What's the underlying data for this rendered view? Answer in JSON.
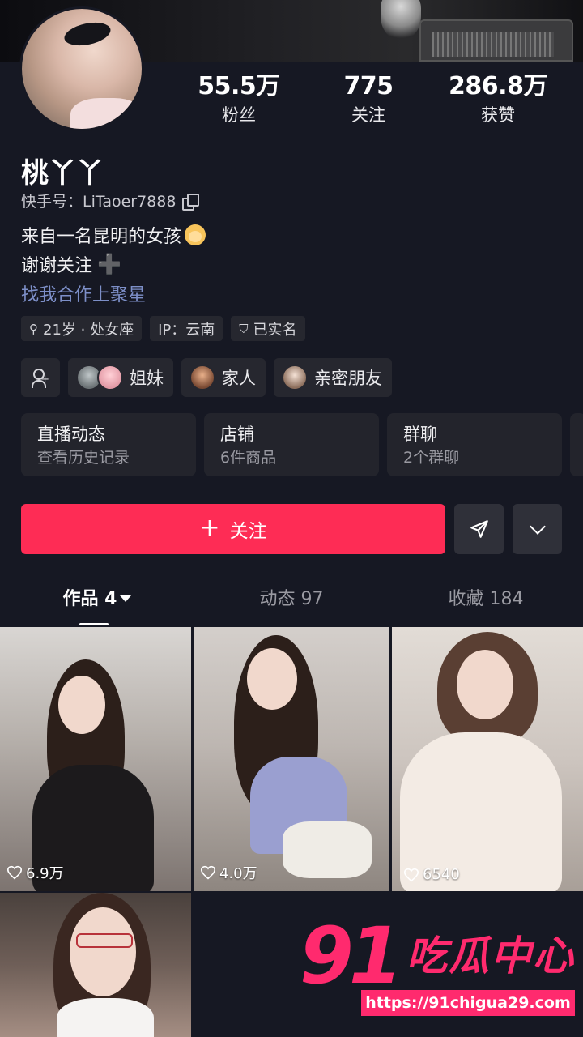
{
  "profile": {
    "name": "桃丫丫",
    "kuaishou_id": "快手号：LiTaoer7888",
    "stats": [
      {
        "value": "55.5万",
        "label": "粉丝"
      },
      {
        "value": "775",
        "label": "关注"
      },
      {
        "value": "286.8万",
        "label": "获赞"
      }
    ],
    "bio_line1": "来自一名昆明的女孩",
    "bio_line2": "谢谢关注",
    "bio_link": "找我合作上聚星",
    "tags": [
      "21岁 · 处女座",
      "IP：云南",
      "已实名"
    ]
  },
  "relations": [
    {
      "label": "姐妹"
    },
    {
      "label": "家人"
    },
    {
      "label": "亲密朋友"
    }
  ],
  "cards": [
    {
      "title": "直播动态",
      "subtitle": "查看历史记录"
    },
    {
      "title": "店铺",
      "subtitle": "6件商品"
    },
    {
      "title": "群聊",
      "subtitle": "2个群聊"
    }
  ],
  "actions": {
    "follow_label": "关注"
  },
  "tabs": [
    {
      "label": "作品 4"
    },
    {
      "label": "动态 97"
    },
    {
      "label": "收藏 184"
    }
  ],
  "works": [
    {
      "likes": "6.9万"
    },
    {
      "likes": "4.0万"
    },
    {
      "likes": "6540"
    }
  ],
  "watermark": {
    "big": "91",
    "cn": "吃瓜中心",
    "url": "https://91chigua29.com"
  },
  "colors": {
    "background": "#161823",
    "accent": "#fe2c55",
    "link": "#7d8fc8",
    "watermark": "#ff2a6e"
  }
}
